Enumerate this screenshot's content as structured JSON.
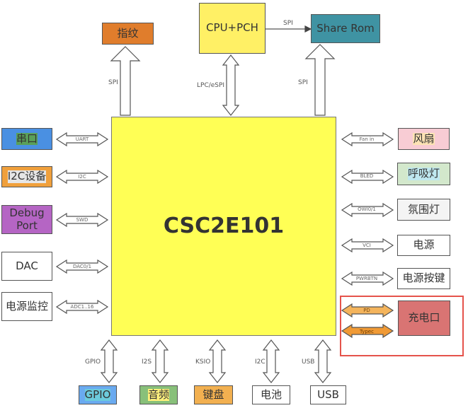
{
  "chip": {
    "label": "CSC2E101",
    "color": "#ffff55"
  },
  "top": {
    "fingerprint": {
      "label": "指纹",
      "color": "#e07d2c",
      "bus": "SPI"
    },
    "cpu": {
      "label": "CPU+PCH",
      "color": "#fff065",
      "bus": "LPC/eSPI"
    },
    "share_rom": {
      "label": "Share Rom",
      "color": "#3f93a3",
      "bus_from_chip": "SPI",
      "bus_from_cpu": "SPI"
    }
  },
  "left": [
    {
      "label": "串口",
      "bus": "UART",
      "color": "#4a90e2"
    },
    {
      "label": "I2C设备",
      "bus": "I2C",
      "color": "#5aa05a"
    },
    {
      "label": "Debug Port",
      "bus": "SWD",
      "color": "#f0a03c"
    },
    {
      "label": "DAC",
      "bus": "DAC0/1",
      "color": "#e6e6e6"
    },
    {
      "label": "电源监控",
      "bus": "ADC1..16",
      "color": "#b565c4"
    }
  ],
  "right": [
    {
      "label": "风扇",
      "bus": "Fan in",
      "color": "#f8ccd4"
    },
    {
      "label": "呼吸灯",
      "bus": "BLED",
      "color": "#fce2b4"
    },
    {
      "label": "氛围灯",
      "bus": "OWI0/1",
      "color": "#d3e8cc"
    },
    {
      "label": "电源",
      "bus": "VCI",
      "color": "#bfe8f0"
    },
    {
      "label": "电源按键",
      "bus": "PWRBTN",
      "color": "#f4f4f4"
    }
  ],
  "charge": {
    "label": "充电口",
    "color": "#d97473",
    "frame_color": "#e5534b",
    "buses": [
      {
        "label": "PD",
        "color": "#f4b45c"
      },
      {
        "label": "Typec",
        "color": "#f09a35"
      }
    ]
  },
  "bottom": [
    {
      "label": "GPIO",
      "bus": "GPIO",
      "color": "#6aaaf0"
    },
    {
      "label": "音频",
      "bus": "I2S",
      "color": "#6ccbdc"
    },
    {
      "label": "键盘",
      "bus": "KSIO",
      "color": "#88c07a"
    },
    {
      "label": "电池",
      "bus": "I2C",
      "color": "#fff07c"
    },
    {
      "label": "USB",
      "bus": "USB",
      "color": "#f2b050"
    }
  ]
}
